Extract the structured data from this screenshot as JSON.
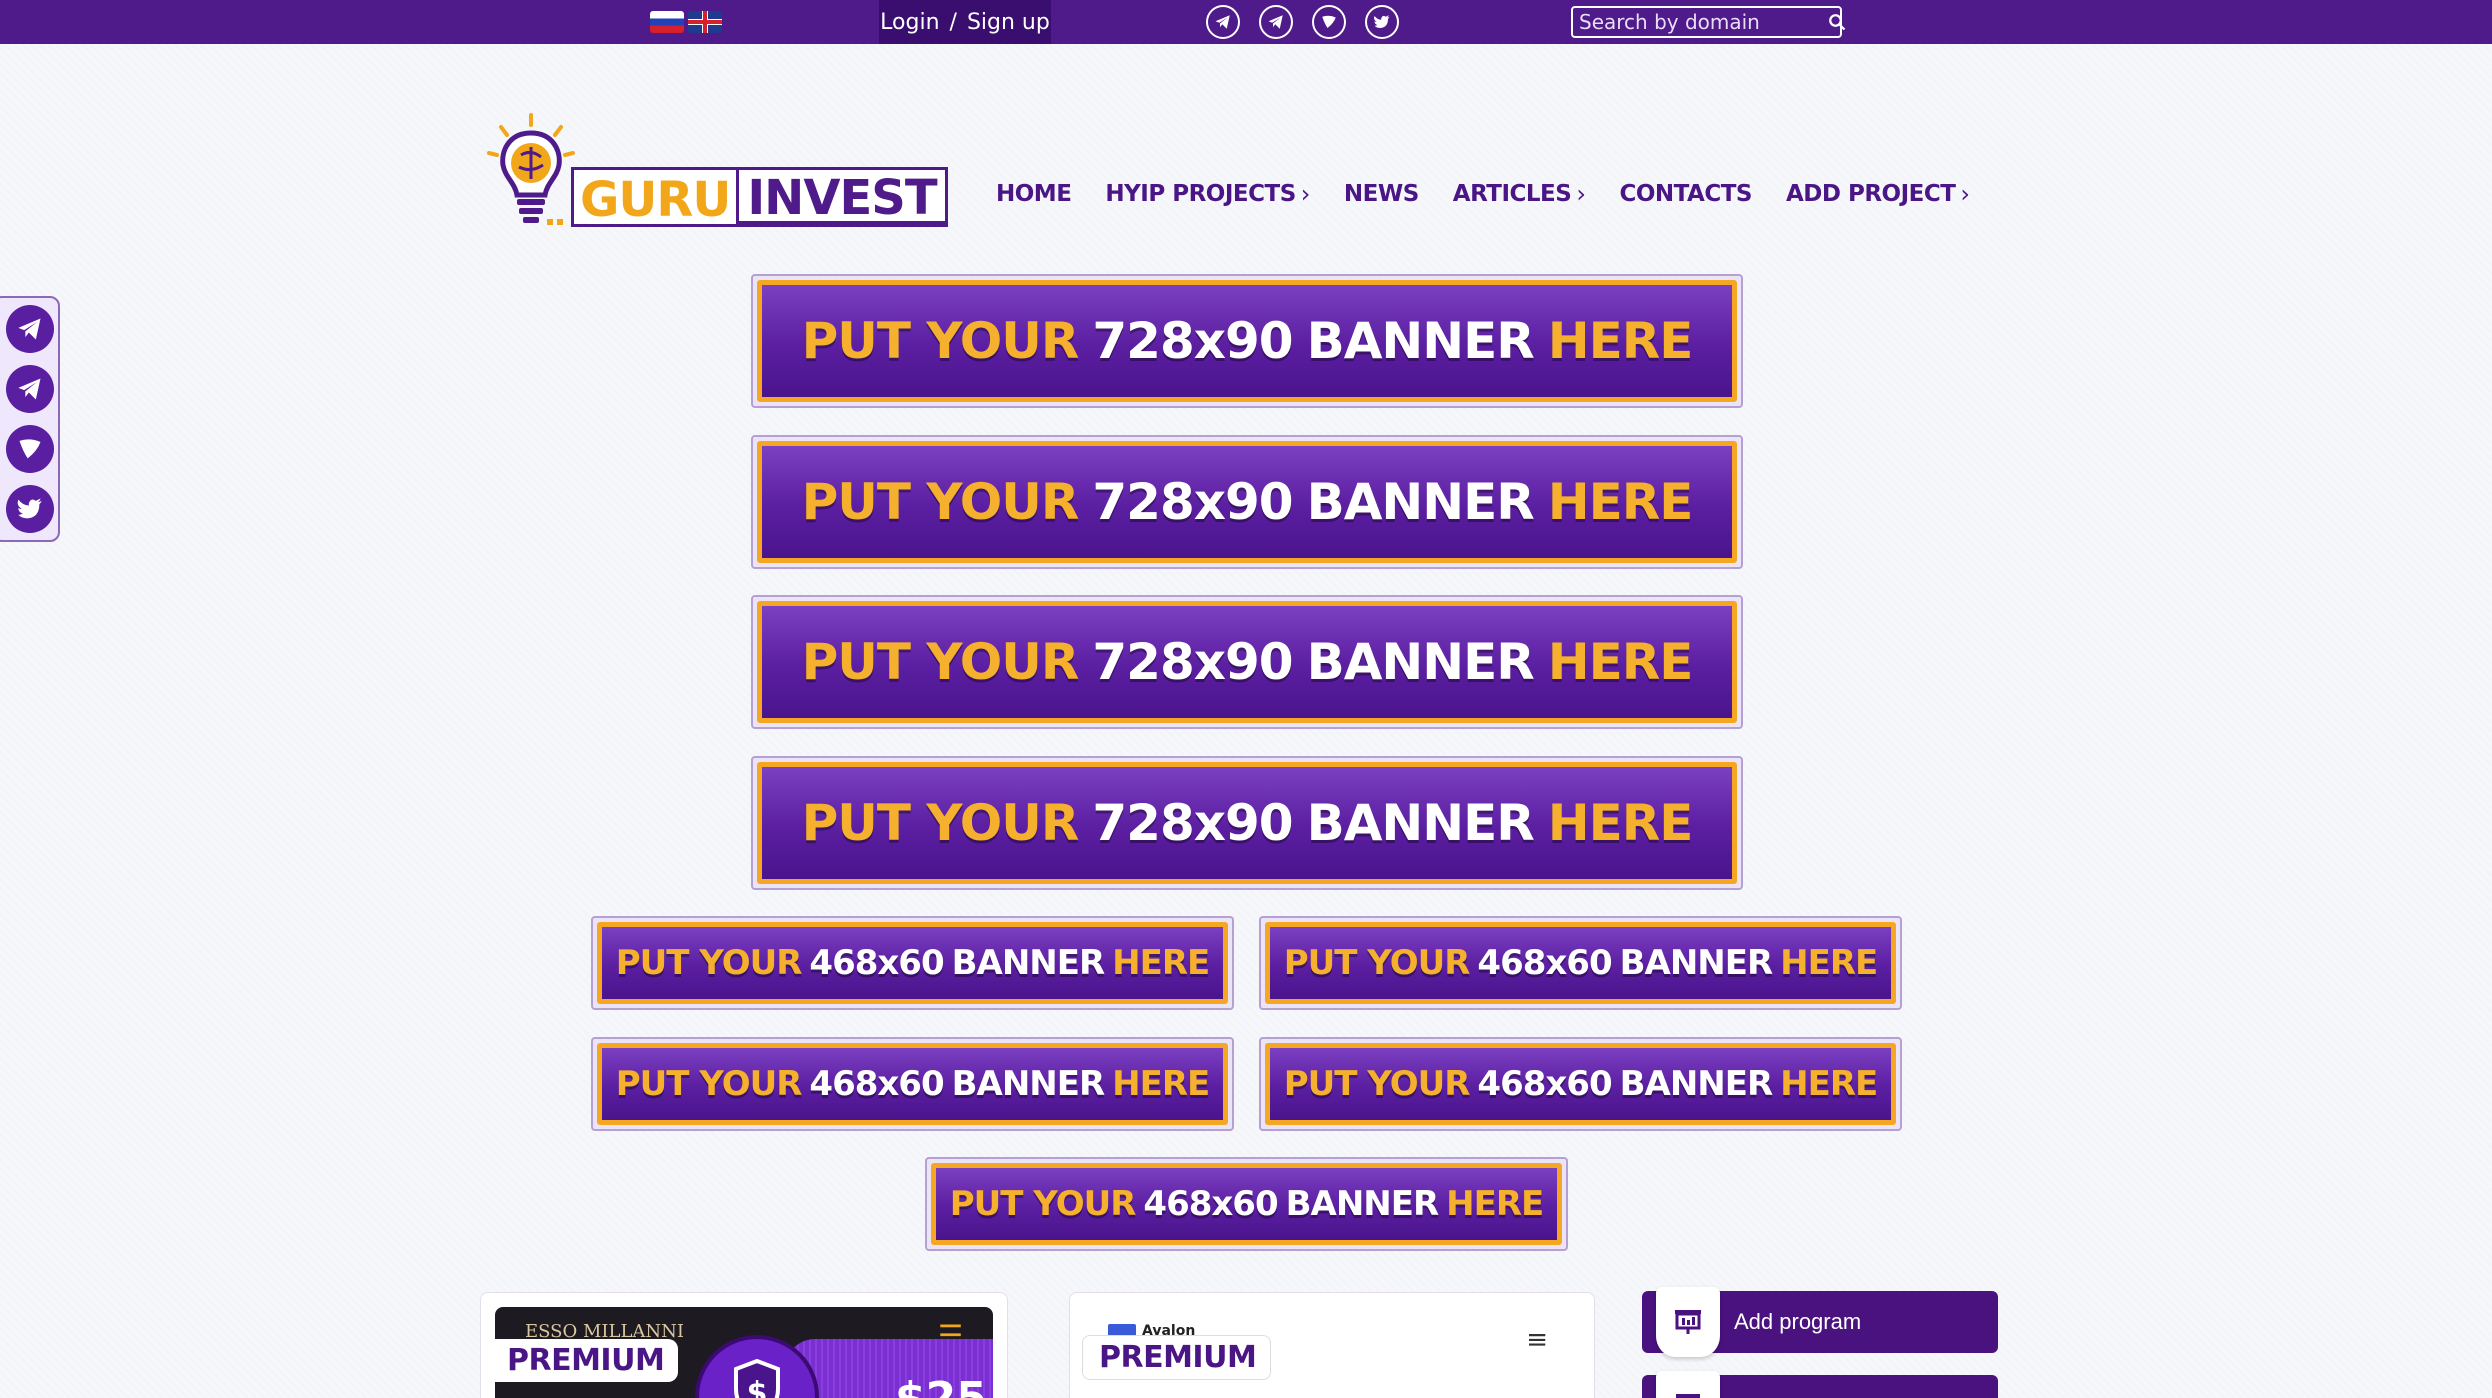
{
  "colors": {
    "brand_purple": "#4f1a8a",
    "nav_purple": "#4a1585",
    "accent_orange": "#f2a71b",
    "banner_yellow": "#f5b02e",
    "page_bg": "#f6f7fb"
  },
  "topbar": {
    "languages": [
      {
        "icon": "flag-ru-icon"
      },
      {
        "icon": "flag-uk-icon"
      }
    ],
    "login_label": "Login",
    "separator": "/",
    "signup_label": "Sign up",
    "socials": [
      {
        "icon": "telegram-icon"
      },
      {
        "icon": "telegram-icon"
      },
      {
        "icon": "discussion-icon"
      },
      {
        "icon": "twitter-icon"
      }
    ],
    "search": {
      "placeholder": "Search by domain",
      "value": "",
      "icon": "search-icon"
    }
  },
  "logo": {
    "part1": "GURU",
    "part2": "INVEST",
    "icon": "lightbulb-brain-icon"
  },
  "nav": {
    "items": [
      {
        "label": "HOME",
        "has_submenu": false
      },
      {
        "label": "HYIP PROJECTS",
        "has_submenu": true
      },
      {
        "label": "NEWS",
        "has_submenu": false
      },
      {
        "label": "ARTICLES",
        "has_submenu": true
      },
      {
        "label": "CONTACTS",
        "has_submenu": false
      },
      {
        "label": "ADD PROJECT",
        "has_submenu": true
      }
    ],
    "chevron": "›"
  },
  "side_socials": [
    {
      "icon": "telegram-icon"
    },
    {
      "icon": "telegram-icon"
    },
    {
      "icon": "discussion-icon"
    },
    {
      "icon": "twitter-icon"
    }
  ],
  "banners": {
    "big": {
      "put_your": "PUT YOUR",
      "size": "728x90",
      "banner_word": "BANNER",
      "here": "HERE"
    },
    "small": {
      "put_your": "PUT YOUR",
      "size": "468x60",
      "banner_word": "BANNER",
      "here": "HERE"
    }
  },
  "cards": [
    {
      "badge": "PREMIUM",
      "site_name": "ESSO MILLANNI",
      "amount": "$25",
      "menu_icon": "hamburger-icon"
    },
    {
      "badge": "PREMIUM",
      "site_name": "Avalon",
      "menu_icon": "hamburger-icon"
    }
  ],
  "sidebar_buttons": [
    {
      "label": "Add program",
      "icon": "presentation-chart-icon"
    },
    {
      "label": "",
      "icon": "dashboard-icon"
    }
  ]
}
